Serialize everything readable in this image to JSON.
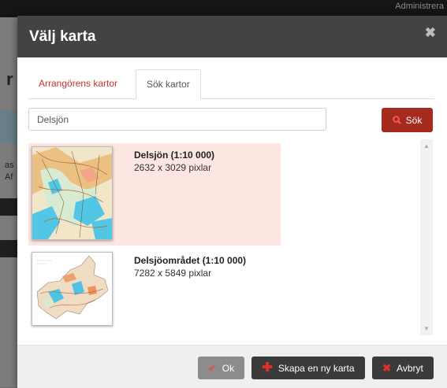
{
  "background": {
    "admin_text": "Administrera",
    "fragments": [
      "r",
      "as",
      "Af"
    ]
  },
  "modal": {
    "title": "Välj karta",
    "close_icon": "close-icon"
  },
  "tabs": [
    {
      "label": "Arrangörens kartor",
      "active": false
    },
    {
      "label": "Sök kartor",
      "active": true
    }
  ],
  "search": {
    "value": "Delsjön",
    "button_label": "Sök"
  },
  "maps": [
    {
      "name": "Delsjön (1:10 000)",
      "size": "2632 x 3029 pixlar",
      "selected": true
    },
    {
      "name": "Delsjöområdet (1:10 000)",
      "size": "7282 x 5849 pixlar",
      "selected": false
    }
  ],
  "footer": {
    "ok_label": "Ok",
    "new_map_label": "Skapa en ny karta",
    "cancel_label": "Avbryt"
  },
  "colors": {
    "header": "#434343",
    "accent": "#a52a1f",
    "selected_row": "#fde5e1",
    "tab_link": "#c9302c"
  }
}
